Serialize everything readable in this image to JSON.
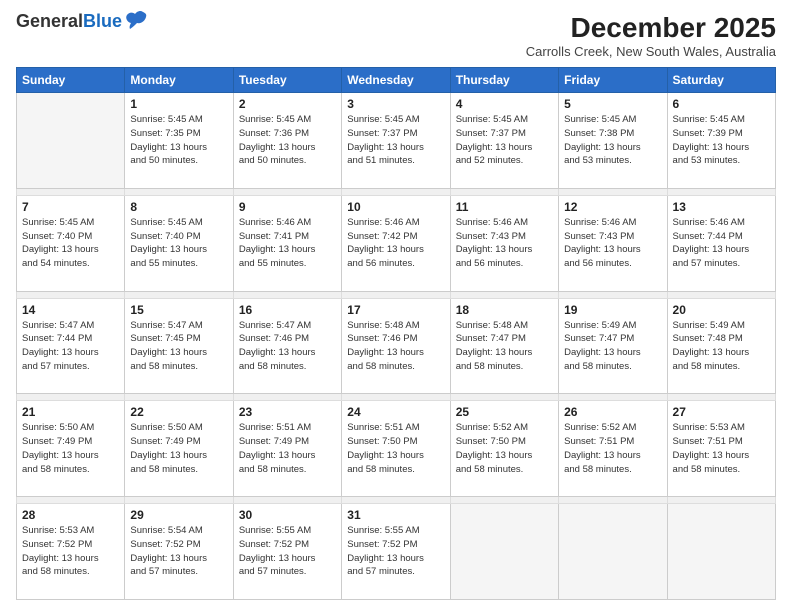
{
  "header": {
    "logo_general": "General",
    "logo_blue": "Blue",
    "month_title": "December 2025",
    "location": "Carrolls Creek, New South Wales, Australia"
  },
  "weekdays": [
    "Sunday",
    "Monday",
    "Tuesday",
    "Wednesday",
    "Thursday",
    "Friday",
    "Saturday"
  ],
  "weeks": [
    [
      {
        "day": "",
        "info": ""
      },
      {
        "day": "1",
        "info": "Sunrise: 5:45 AM\nSunset: 7:35 PM\nDaylight: 13 hours\nand 50 minutes."
      },
      {
        "day": "2",
        "info": "Sunrise: 5:45 AM\nSunset: 7:36 PM\nDaylight: 13 hours\nand 50 minutes."
      },
      {
        "day": "3",
        "info": "Sunrise: 5:45 AM\nSunset: 7:37 PM\nDaylight: 13 hours\nand 51 minutes."
      },
      {
        "day": "4",
        "info": "Sunrise: 5:45 AM\nSunset: 7:37 PM\nDaylight: 13 hours\nand 52 minutes."
      },
      {
        "day": "5",
        "info": "Sunrise: 5:45 AM\nSunset: 7:38 PM\nDaylight: 13 hours\nand 53 minutes."
      },
      {
        "day": "6",
        "info": "Sunrise: 5:45 AM\nSunset: 7:39 PM\nDaylight: 13 hours\nand 53 minutes."
      }
    ],
    [
      {
        "day": "7",
        "info": "Sunrise: 5:45 AM\nSunset: 7:40 PM\nDaylight: 13 hours\nand 54 minutes."
      },
      {
        "day": "8",
        "info": "Sunrise: 5:45 AM\nSunset: 7:40 PM\nDaylight: 13 hours\nand 55 minutes."
      },
      {
        "day": "9",
        "info": "Sunrise: 5:46 AM\nSunset: 7:41 PM\nDaylight: 13 hours\nand 55 minutes."
      },
      {
        "day": "10",
        "info": "Sunrise: 5:46 AM\nSunset: 7:42 PM\nDaylight: 13 hours\nand 56 minutes."
      },
      {
        "day": "11",
        "info": "Sunrise: 5:46 AM\nSunset: 7:43 PM\nDaylight: 13 hours\nand 56 minutes."
      },
      {
        "day": "12",
        "info": "Sunrise: 5:46 AM\nSunset: 7:43 PM\nDaylight: 13 hours\nand 56 minutes."
      },
      {
        "day": "13",
        "info": "Sunrise: 5:46 AM\nSunset: 7:44 PM\nDaylight: 13 hours\nand 57 minutes."
      }
    ],
    [
      {
        "day": "14",
        "info": "Sunrise: 5:47 AM\nSunset: 7:44 PM\nDaylight: 13 hours\nand 57 minutes."
      },
      {
        "day": "15",
        "info": "Sunrise: 5:47 AM\nSunset: 7:45 PM\nDaylight: 13 hours\nand 58 minutes."
      },
      {
        "day": "16",
        "info": "Sunrise: 5:47 AM\nSunset: 7:46 PM\nDaylight: 13 hours\nand 58 minutes."
      },
      {
        "day": "17",
        "info": "Sunrise: 5:48 AM\nSunset: 7:46 PM\nDaylight: 13 hours\nand 58 minutes."
      },
      {
        "day": "18",
        "info": "Sunrise: 5:48 AM\nSunset: 7:47 PM\nDaylight: 13 hours\nand 58 minutes."
      },
      {
        "day": "19",
        "info": "Sunrise: 5:49 AM\nSunset: 7:47 PM\nDaylight: 13 hours\nand 58 minutes."
      },
      {
        "day": "20",
        "info": "Sunrise: 5:49 AM\nSunset: 7:48 PM\nDaylight: 13 hours\nand 58 minutes."
      }
    ],
    [
      {
        "day": "21",
        "info": "Sunrise: 5:50 AM\nSunset: 7:49 PM\nDaylight: 13 hours\nand 58 minutes."
      },
      {
        "day": "22",
        "info": "Sunrise: 5:50 AM\nSunset: 7:49 PM\nDaylight: 13 hours\nand 58 minutes."
      },
      {
        "day": "23",
        "info": "Sunrise: 5:51 AM\nSunset: 7:49 PM\nDaylight: 13 hours\nand 58 minutes."
      },
      {
        "day": "24",
        "info": "Sunrise: 5:51 AM\nSunset: 7:50 PM\nDaylight: 13 hours\nand 58 minutes."
      },
      {
        "day": "25",
        "info": "Sunrise: 5:52 AM\nSunset: 7:50 PM\nDaylight: 13 hours\nand 58 minutes."
      },
      {
        "day": "26",
        "info": "Sunrise: 5:52 AM\nSunset: 7:51 PM\nDaylight: 13 hours\nand 58 minutes."
      },
      {
        "day": "27",
        "info": "Sunrise: 5:53 AM\nSunset: 7:51 PM\nDaylight: 13 hours\nand 58 minutes."
      }
    ],
    [
      {
        "day": "28",
        "info": "Sunrise: 5:53 AM\nSunset: 7:52 PM\nDaylight: 13 hours\nand 58 minutes."
      },
      {
        "day": "29",
        "info": "Sunrise: 5:54 AM\nSunset: 7:52 PM\nDaylight: 13 hours\nand 57 minutes."
      },
      {
        "day": "30",
        "info": "Sunrise: 5:55 AM\nSunset: 7:52 PM\nDaylight: 13 hours\nand 57 minutes."
      },
      {
        "day": "31",
        "info": "Sunrise: 5:55 AM\nSunset: 7:52 PM\nDaylight: 13 hours\nand 57 minutes."
      },
      {
        "day": "",
        "info": ""
      },
      {
        "day": "",
        "info": ""
      },
      {
        "day": "",
        "info": ""
      }
    ]
  ]
}
